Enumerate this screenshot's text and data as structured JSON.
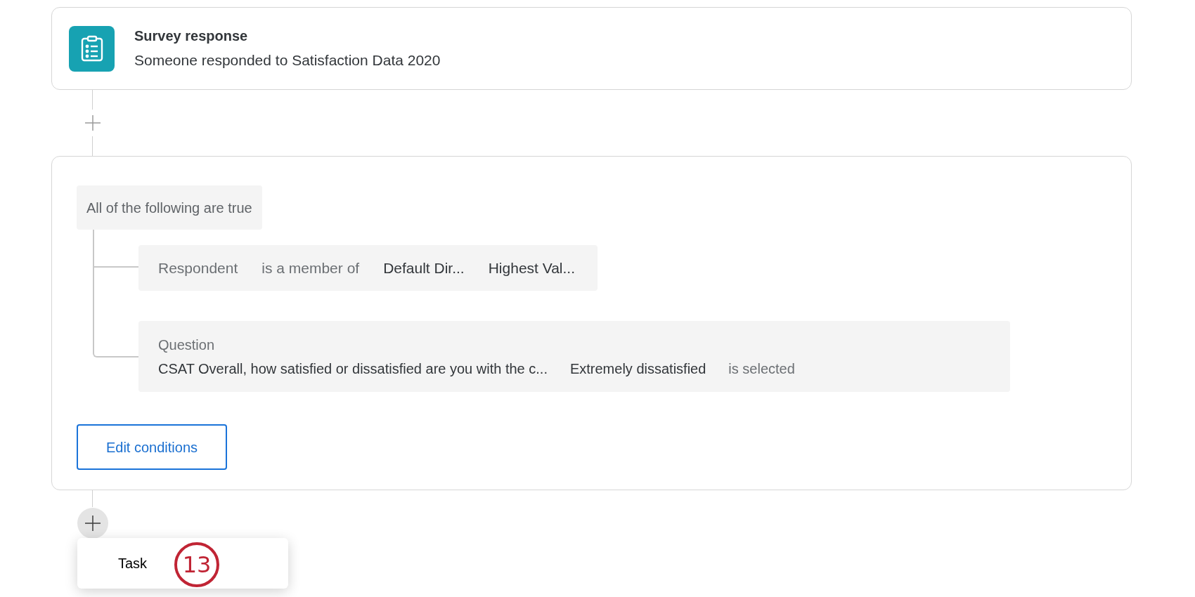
{
  "trigger": {
    "title": "Survey response",
    "description": "Someone responded to Satisfaction Data 2020"
  },
  "condition_group": {
    "label": "All of the following are true",
    "conditions": [
      {
        "kind": "inline",
        "segments": [
          {
            "kind": "field",
            "text": "Respondent"
          },
          {
            "kind": "operator",
            "text": "is a member of"
          },
          {
            "kind": "value",
            "text": "Default Dir..."
          },
          {
            "kind": "value",
            "text": "Highest Val..."
          }
        ]
      },
      {
        "kind": "stacked",
        "segments": [
          {
            "kind": "field",
            "text": "Question"
          },
          {
            "kind": "value",
            "text": "CSAT Overall, how satisfied or dissatisfied are you with the c..."
          },
          {
            "kind": "value",
            "text": "Extremely dissatisfied"
          },
          {
            "kind": "operator",
            "text": "is selected"
          }
        ]
      }
    ],
    "edit_button": "Edit conditions"
  },
  "add_menu": {
    "items": [
      {
        "label": "Task"
      }
    ]
  },
  "callout": "13"
}
